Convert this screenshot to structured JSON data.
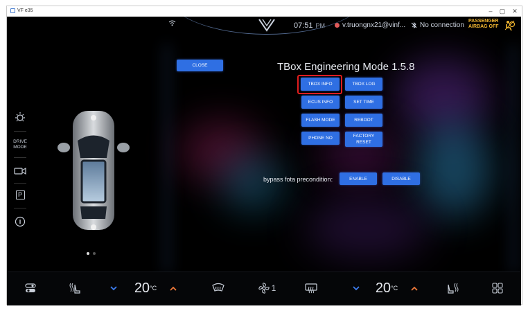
{
  "window": {
    "title": "VF e35",
    "controls": [
      "–",
      "▢",
      "✕"
    ]
  },
  "statusbar": {
    "time": "07:51",
    "ampm": "PM",
    "user": "v.truongnx21@vinf...",
    "connection": "No connection",
    "airbag_line1": "PASSENGER",
    "airbag_line2": "AIRBAG OFF"
  },
  "left_panel": {
    "drive_mode_line1": "DRIVE",
    "drive_mode_line2": "MODE",
    "park_label": "P"
  },
  "engineering": {
    "title": "TBox Engineering Mode 1.5.8",
    "close_label": "CLOSE",
    "buttons": {
      "tbox_info": "TBOX INFO",
      "tbox_log": "TBOX LOG",
      "ecus_info": "ECUS INFO",
      "set_time": "SET TIME",
      "flash_mode": "FLASH MODE",
      "reboot": "REBOOT",
      "phone_no": "PHONE NO",
      "factory_reset_line1": "FACTORY",
      "factory_reset_line2": "RESET"
    },
    "bypass_label": "bypass fota precondition:",
    "enable_label": "ENABLE",
    "disable_label": "DISABLE"
  },
  "climate": {
    "left_temp": "20",
    "right_temp": "20",
    "unit": "°C",
    "fan_level": "1"
  },
  "colors": {
    "accent_button": "#2f6fe3",
    "highlight": "#e11d1d",
    "temp_down": "#3d7df0",
    "temp_up": "#f07a3a",
    "airbag_warning": "#f2b731"
  }
}
